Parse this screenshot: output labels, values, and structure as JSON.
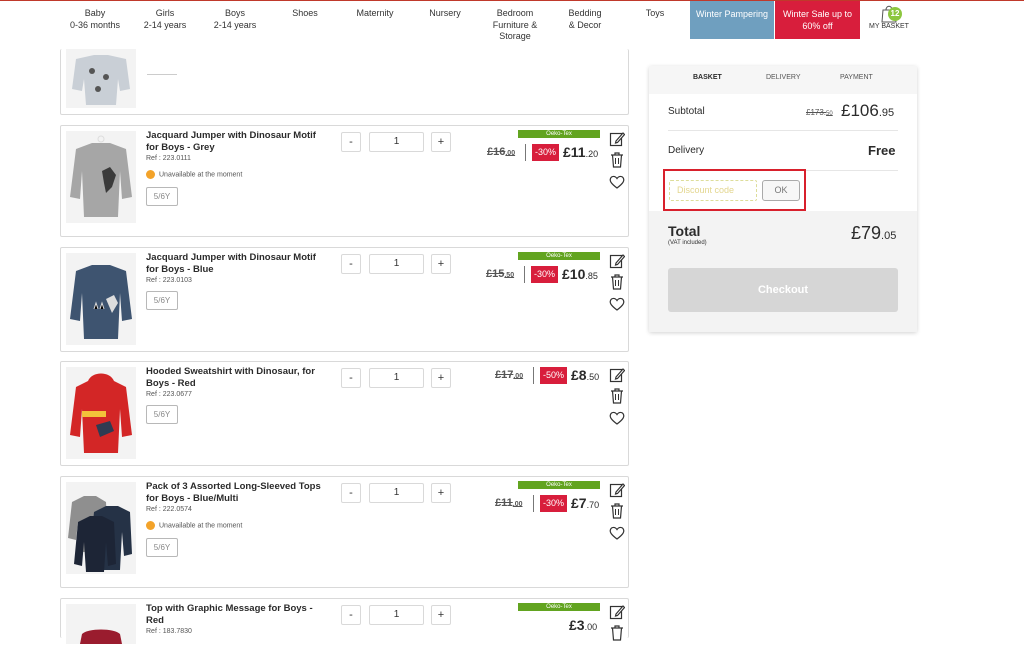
{
  "nav": {
    "baby": {
      "l1": "Baby",
      "l2": "0-36 months"
    },
    "girls": {
      "l1": "Girls",
      "l2": "2-14 years"
    },
    "boys": {
      "l1": "Boys",
      "l2": "2-14 years"
    },
    "shoes": {
      "l1": "Shoes"
    },
    "maternity": {
      "l1": "Maternity"
    },
    "nursery": {
      "l1": "Nursery"
    },
    "bedroom": {
      "l1": "Bedroom",
      "l2": "Furniture &",
      "l3": "Storage"
    },
    "bedding": {
      "l1": "Bedding",
      "l2": "& Decor"
    },
    "toys": {
      "l1": "Toys"
    },
    "winter_pampering": {
      "l1": "Winter",
      "l2": "Pampering",
      "color": "#6f9fbf"
    },
    "winter_sale": {
      "l1": "Winter Sale",
      "l2": "up to 60% off",
      "color": "#d81e3c"
    },
    "basket": {
      "label": "MY BASKET",
      "count": "12"
    }
  },
  "products": [
    {
      "title": "Jacquard Jumper with Dinosaur Motif for Boys - Grey",
      "ref": "Ref : 223.0111",
      "availability": "Unavailable at the moment",
      "size": "5/6Y",
      "qty": "1",
      "label": "Oeko-Tex",
      "old_price": "£16",
      "old_price_dec": ".00",
      "discount": "-30%",
      "price": "£11",
      "price_dec": ".20"
    },
    {
      "title": "Jacquard Jumper with Dinosaur Motif for Boys - Blue",
      "ref": "Ref : 223.0103",
      "size": "5/6Y",
      "qty": "1",
      "label": "Oeko-Tex",
      "old_price": "£15",
      "old_price_dec": ".50",
      "discount": "-30%",
      "price": "£10",
      "price_dec": ".85"
    },
    {
      "title": "Hooded Sweatshirt with Dinosaur, for Boys - Red",
      "ref": "Ref : 223.0677",
      "size": "5/6Y",
      "qty": "1",
      "old_price": "£17",
      "old_price_dec": ".00",
      "discount": "-50%",
      "price": "£8",
      "price_dec": ".50"
    },
    {
      "title": "Pack of 3 Assorted Long-Sleeved Tops for Boys - Blue/Multi",
      "ref": "Ref : 222.0574",
      "availability": "Unavailable at the moment",
      "size": "5/6Y",
      "qty": "1",
      "label": "Oeko-Tex",
      "old_price": "£11",
      "old_price_dec": ".00",
      "discount": "-30%",
      "price": "£7",
      "price_dec": ".70"
    },
    {
      "title": "Top with Graphic Message for Boys - Red",
      "ref": "Ref : 183.7830",
      "qty": "1",
      "label": "Oeko-Tex",
      "price": "£3",
      "price_dec": ".00"
    }
  ],
  "summary": {
    "steps": [
      "BASKET",
      "DELIVERY",
      "PAYMENT"
    ],
    "subtotal_label": "Subtotal",
    "subtotal_old": "£173.",
    "subtotal_old_dec": "50",
    "subtotal": "£106",
    "subtotal_dec": ".95",
    "delivery_label": "Delivery",
    "delivery_value": "Free",
    "discount_placeholder": "Discount code",
    "ok_label": "OK",
    "total_label": "Total",
    "vat_note": "(VAT included)",
    "total": "£79",
    "total_dec": ".05",
    "checkout_label": "Checkout"
  },
  "colors": {
    "accent_red": "#d81e3c",
    "oeko_green": "#62a420",
    "highlight_box": "#d8202c"
  }
}
